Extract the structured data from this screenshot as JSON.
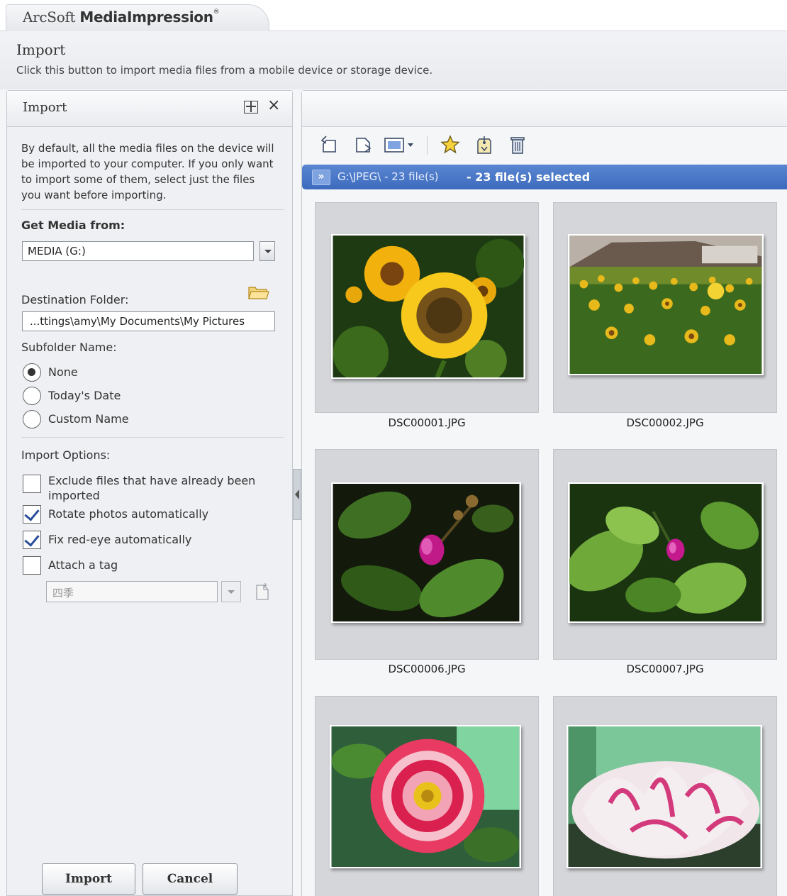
{
  "app": {
    "brand_part1": "ArcSoft",
    "brand_part2": "MediaImpression",
    "brand_mark": "®"
  },
  "header": {
    "title": "Import",
    "description": "Click this button to import media files from a mobile device or storage device."
  },
  "import_panel": {
    "title": "Import",
    "close_glyph": "×",
    "intro": "By default, all the media files on the device will be imported to your computer. If you only want to import some of them, select just the files you want before importing.",
    "get_media_label": "Get Media from:",
    "source_value": "MEDIA (G:)",
    "destination_label": "Destination Folder:",
    "destination_value": "...ttings\\amy\\My Documents\\My Pictures",
    "subfolder_label": "Subfolder Name:",
    "subfolder_options": [
      {
        "label": "None",
        "selected": true
      },
      {
        "label": "Today's Date",
        "selected": false
      },
      {
        "label": "Custom Name",
        "selected": false
      }
    ],
    "options_label": "Import Options:",
    "options": [
      {
        "label": "Exclude files that have already been imported",
        "checked": false
      },
      {
        "label": "Rotate photos automatically",
        "checked": true
      },
      {
        "label": "Fix red-eye automatically",
        "checked": true
      },
      {
        "label": "Attach a tag",
        "checked": false
      }
    ],
    "tag_value": "四季",
    "import_button": "Import",
    "cancel_button": "Cancel"
  },
  "browser": {
    "path": "G:\\JPEG\\ - 23 file(s)",
    "selection": "- 23 file(s) selected",
    "chevron": "»",
    "toolbar_icons": [
      "rotate-left-icon",
      "rotate-right-icon",
      "view-mode-icon",
      "star-icon",
      "tag-icon",
      "delete-icon"
    ],
    "thumbnails": [
      {
        "filename": "DSC00001.JPG",
        "subject": "sunflower"
      },
      {
        "filename": "DSC00002.JPG",
        "subject": "sunflower-field"
      },
      {
        "filename": "DSC00006.JPG",
        "subject": "pink-bud"
      },
      {
        "filename": "DSC00007.JPG",
        "subject": "pink-bud-leaves"
      },
      {
        "filename": "",
        "subject": "red-peony"
      },
      {
        "filename": "",
        "subject": "pink-white-peony"
      }
    ]
  },
  "colors": {
    "selection_bar": "#4a78c8",
    "thumb_background": "#d5d6da",
    "check_accent": "#2a4f9a"
  }
}
